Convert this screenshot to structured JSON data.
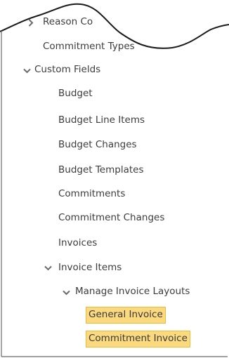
{
  "tree": {
    "items": [
      {
        "label": "Reason Co",
        "icon": "chevron-right-icon"
      },
      {
        "label": "Commitment Types"
      },
      {
        "label": "Custom Fields",
        "icon": "chevron-down-icon"
      },
      {
        "label": "Budget"
      },
      {
        "label": "Budget Line Items"
      },
      {
        "label": "Budget Changes"
      },
      {
        "label": "Budget Templates"
      },
      {
        "label": "Commitments"
      },
      {
        "label": "Commitment Changes"
      },
      {
        "label": "Invoices"
      },
      {
        "label": "Invoice Items",
        "icon": "chevron-down-icon"
      },
      {
        "label": "Manage Invoice Layouts",
        "icon": "chevron-down-icon"
      },
      {
        "label": "General Invoice",
        "highlighted": true
      },
      {
        "label": "Commitment Invoice",
        "highlighted": true
      }
    ]
  },
  "colors": {
    "highlight_fill": "#fbd97f",
    "highlight_border": "#f0b93a",
    "text": "#3c3c3c"
  }
}
